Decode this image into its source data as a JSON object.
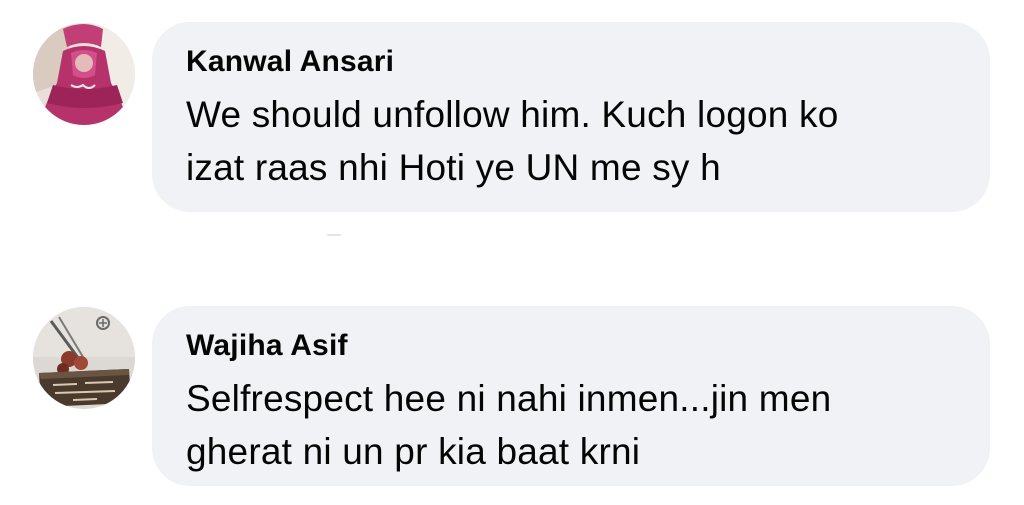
{
  "comments": [
    {
      "author": "Kanwal Ansari",
      "lines": [
        "We should unfollow him. Kuch logon ko",
        "izat raas nhi Hoti ye UN me sy h"
      ],
      "avatar_icon": "woman-in-pink-dress-avatar"
    },
    {
      "author": "Wajiha Asif",
      "lines": [
        "Selfrespect hee ni nahi inmen...jin men",
        "gherat ni un pr kia baat krni"
      ],
      "avatar_icon": "book-and-flowers-avatar"
    }
  ],
  "colors": {
    "bubble_bg": "#f0f2f5",
    "text": "#050505",
    "page_bg": "#ffffff"
  }
}
